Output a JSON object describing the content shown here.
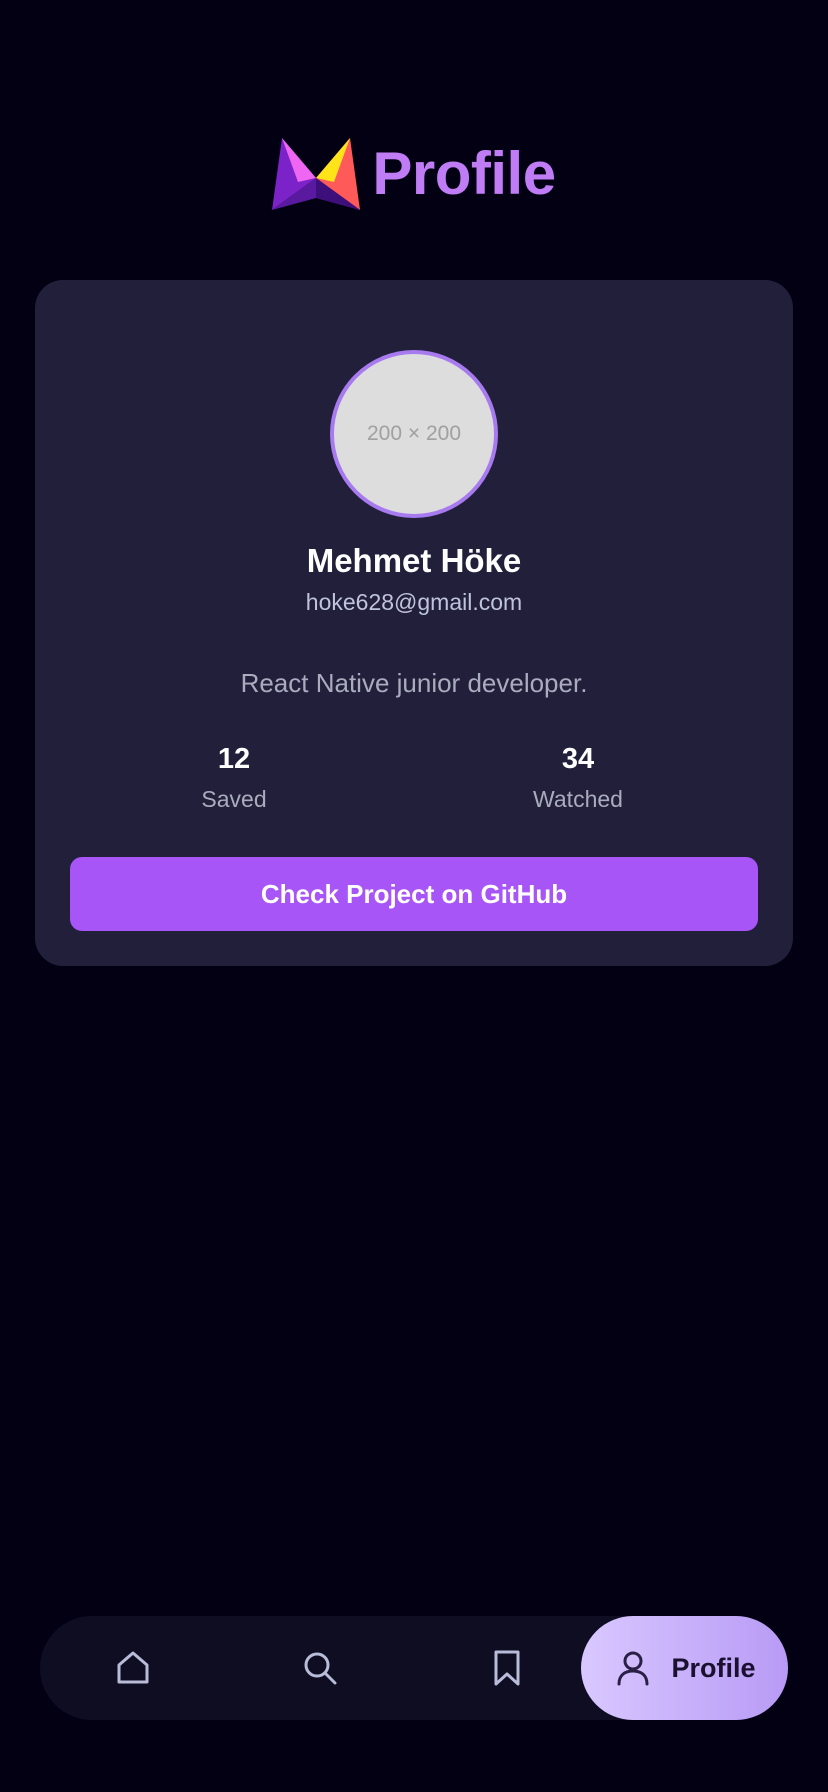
{
  "header": {
    "title": "Profile",
    "logo_icon": "triangle-bow-logo"
  },
  "profile": {
    "avatar_placeholder": "200 × 200",
    "name": "Mehmet Höke",
    "email": "hoke628@gmail.com",
    "bio": "React Native junior developer.",
    "stats": [
      {
        "value": "12",
        "label": "Saved"
      },
      {
        "value": "34",
        "label": "Watched"
      }
    ],
    "github_button_label": "Check Project on GitHub"
  },
  "tabbar": {
    "items": [
      {
        "icon": "home-icon",
        "label": ""
      },
      {
        "icon": "search-icon",
        "label": ""
      },
      {
        "icon": "bookmark-icon",
        "label": ""
      },
      {
        "icon": "user-icon",
        "label": "Profile",
        "active": true
      }
    ]
  },
  "colors": {
    "background": "#030014",
    "card": "#221f3b",
    "accent": "#a855f7",
    "title": "#c07cf5",
    "active_tab_start": "#d9c8ff",
    "active_tab_end": "#b89af5"
  }
}
